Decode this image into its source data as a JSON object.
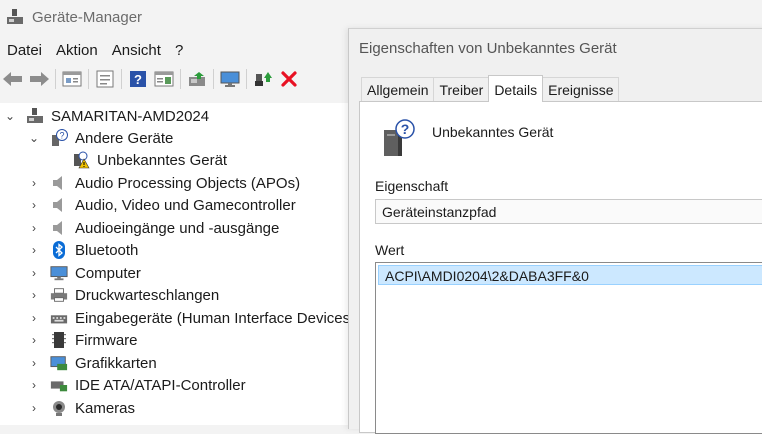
{
  "window": {
    "title": "Geräte-Manager"
  },
  "menu": [
    "Datei",
    "Aktion",
    "Ansicht",
    "?"
  ],
  "toolbar": {
    "icons": [
      "back-arrow-icon",
      "forward-arrow-icon",
      "properties-icon",
      "list-icon",
      "help-icon",
      "view-icon",
      "update-driver-icon",
      "monitor-icon",
      "enable-device-icon",
      "uninstall-icon"
    ]
  },
  "tree": {
    "root": "SAMARITAN-AMD2024",
    "items": [
      {
        "label": "Andere Geräte",
        "expanded": true
      },
      {
        "label": "Unbekanntes Gerät",
        "child": true
      },
      {
        "label": "Audio Processing Objects (APOs)"
      },
      {
        "label": "Audio, Video und Gamecontroller"
      },
      {
        "label": "Audioeingänge und -ausgänge"
      },
      {
        "label": "Bluetooth"
      },
      {
        "label": "Computer"
      },
      {
        "label": "Druckwarteschlangen"
      },
      {
        "label": "Eingabegeräte (Human Interface Devices)"
      },
      {
        "label": "Firmware"
      },
      {
        "label": "Grafikkarten"
      },
      {
        "label": "IDE ATA/ATAPI-Controller"
      },
      {
        "label": "Kameras"
      }
    ]
  },
  "dialog": {
    "title": "Eigenschaften von Unbekanntes Gerät",
    "tabs": [
      "Allgemein",
      "Treiber",
      "Details",
      "Ereignisse"
    ],
    "active_tab": "Details",
    "device_name": "Unbekanntes Gerät",
    "property_label": "Eigenschaft",
    "property_value": "Geräteinstanzpfad",
    "value_label": "Wert",
    "value_entry": "ACPI\\AMDI0204\\2&DABA3FF&0"
  },
  "colors": {
    "selection": "#cce8ff",
    "uninstall": "#e81123",
    "bluetooth": "#0a6cd6"
  }
}
